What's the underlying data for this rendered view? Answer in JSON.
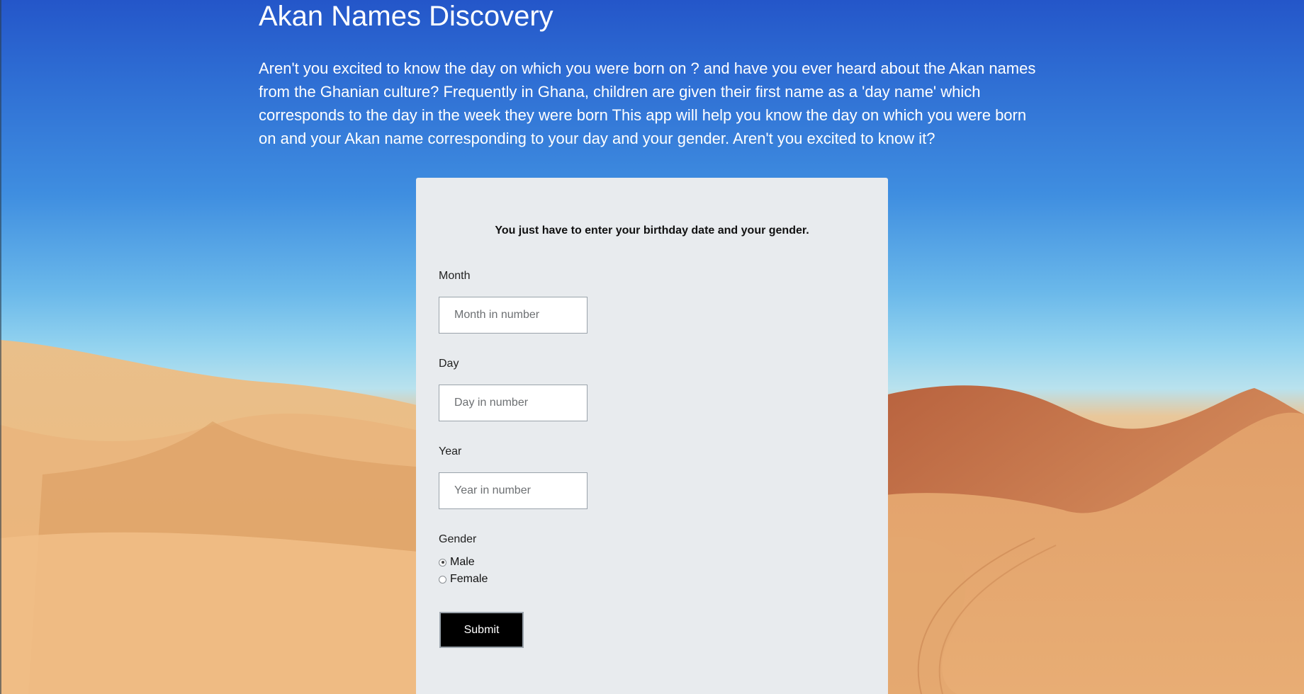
{
  "header": {
    "title": "Akan Names Discovery",
    "intro": "Aren't you excited to know the day on which you were born on ? and have you ever heard about the Akan names from the Ghanian culture? Frequently in Ghana, children are given their first name as a 'day name' which corresponds to the day in the week they were born This app will help you know the day on which you were born on and your Akan name corresponding to your day and your gender. Aren't you excited to know it?"
  },
  "form": {
    "heading": "You just have to enter your birthday date and your gender.",
    "month": {
      "label": "Month",
      "placeholder": "Month in number",
      "value": ""
    },
    "day": {
      "label": "Day",
      "placeholder": "Day in number",
      "value": ""
    },
    "year": {
      "label": "Year",
      "placeholder": "Year in number",
      "value": ""
    },
    "gender": {
      "label": "Gender",
      "options": [
        "Male",
        "Female"
      ],
      "selected": "Male"
    },
    "submit_label": "Submit"
  },
  "colors": {
    "sky_top": "#2456c9",
    "sand": "#e6ad6e",
    "card_bg": "#e8ebee",
    "button_bg": "#000000"
  }
}
